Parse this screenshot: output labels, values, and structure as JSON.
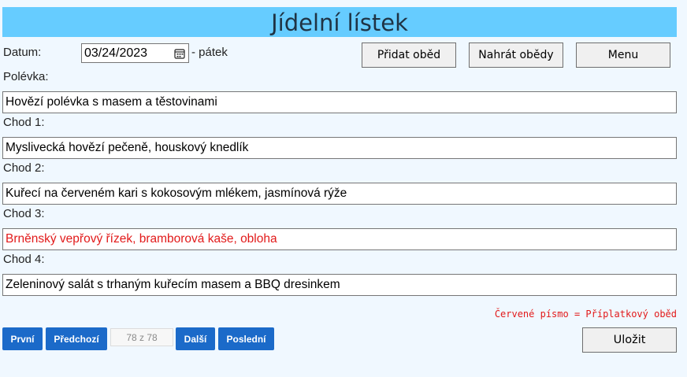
{
  "header": {
    "title": "Jídelní lístek"
  },
  "date": {
    "label": "Datum:",
    "value": "03/24/2023",
    "weekday": "- pátek"
  },
  "toolbar": {
    "add_lunch": "Přidat oběd",
    "upload_lunches": "Nahrát obědy",
    "menu": "Menu"
  },
  "fields": {
    "soup_label": "Polévka:",
    "soup_value": "Hovězí polévka s masem a těstovinami",
    "course1_label": "Chod 1:",
    "course1_value": "Myslivecká hovězí pečeně, houskový knedlík",
    "course2_label": "Chod 2:",
    "course2_value": "Kuřecí na červeném kari s kokosovým mlékem, jasmínová rýže",
    "course3_label": "Chod 3:",
    "course3_value": "Brněnský vepřový řízek, bramborová kaše, obloha",
    "course4_label": "Chod 4:",
    "course4_value": "Zeleninový salát s trhaným kuřecím masem a BBQ dresinkem"
  },
  "note": "Červené písmo = Příplatkový oběd",
  "pager": {
    "first": "První",
    "previous": "Předchozí",
    "count": "78 z 78",
    "next": "Další",
    "last": "Poslední"
  },
  "save_label": "Uložit",
  "colors": {
    "header_bg": "#66ccff",
    "page_bg": "#f0f8ff",
    "pager_blue": "#1b6ac9",
    "surcharge_red": "#e21a1a"
  }
}
